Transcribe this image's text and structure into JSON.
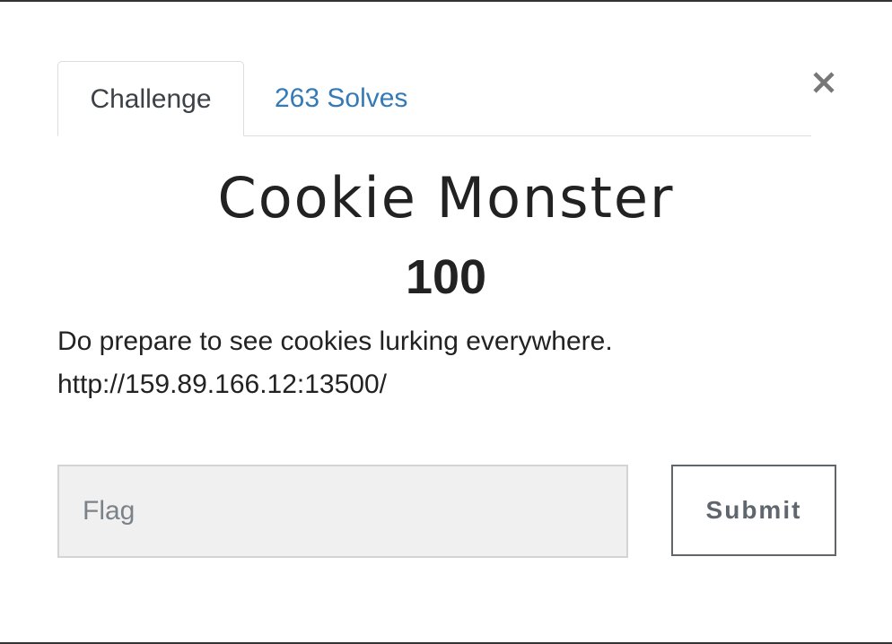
{
  "tabs": {
    "challenge_label": "Challenge",
    "solves_label": "263 Solves"
  },
  "challenge": {
    "name": "Cookie Monster",
    "points": "100",
    "description": "Do prepare to see cookies lurking everywhere.",
    "url": "http://159.89.166.12:13500/"
  },
  "form": {
    "flag_placeholder": "Flag",
    "flag_value": "",
    "submit_label": "Submit"
  },
  "icons": {
    "close": "close-icon"
  },
  "colors": {
    "link": "#337ab7",
    "text": "#222222",
    "button_border": "#5f666d",
    "input_bg": "#f0f0f0"
  }
}
